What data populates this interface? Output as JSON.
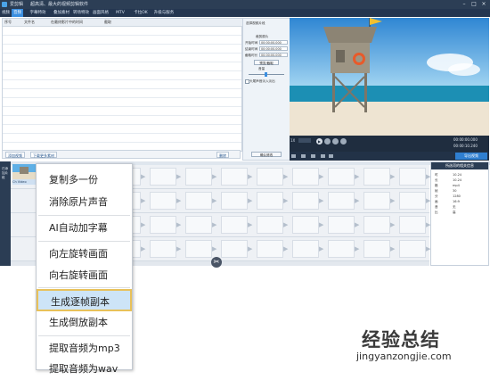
{
  "window": {
    "app_name": "爱剪辑",
    "title": "超高清、最大的视频剪辑软件",
    "buttons": [
      "–",
      "□",
      "×"
    ]
  },
  "tabs": [
    {
      "label": "视频"
    },
    {
      "label": "音频"
    },
    {
      "label": "字幕特效"
    },
    {
      "label": "叠加素材"
    },
    {
      "label": "转场特效"
    },
    {
      "label": "画面风格"
    },
    {
      "label": "MTV"
    },
    {
      "label": "卡拉OK"
    },
    {
      "label": "升级与服务"
    }
  ],
  "clip_list": {
    "columns": [
      "序号",
      "文件名",
      "在最终影片中的时间",
      "截取"
    ],
    "add_video_button": "添加视频",
    "download_button": "下载更多素材",
    "delete_button": "删除"
  },
  "settings": {
    "header": "选择视频片段",
    "section1": "裁剪原片",
    "start_label": "开始时间",
    "start_value": "00:00:00.000",
    "end_label": "结束时间",
    "end_value": "00:00:00.000",
    "duration_label": "截取时长",
    "duration_value": "00:00:00.000",
    "preview_button": "预览/截取",
    "volume_section": "音量",
    "checkbox_label": "头尾声音淡入淡出",
    "confirm_button": "确认修改"
  },
  "player": {
    "time_current": "00:00:00.000",
    "time_total": "00:00:10.240",
    "speed_value": "1X",
    "export_button": "导出视频"
  },
  "timeline": {
    "panel_label": "已添加片段",
    "clip_label": "Ch Video 01.mp4"
  },
  "props": {
    "header": "所选项的相关信息",
    "rows": [
      {
        "k": "时",
        "v": "10.24"
      },
      {
        "k": "长",
        "v": "10.24"
      },
      {
        "k": "格",
        "v": "mp4"
      },
      {
        "k": "帧",
        "v": "30"
      },
      {
        "k": "分",
        "v": "1280"
      },
      {
        "k": "画",
        "v": "16:9"
      },
      {
        "k": "音",
        "v": "无"
      },
      {
        "k": "比",
        "v": "高"
      }
    ]
  },
  "context_menu": {
    "items": [
      {
        "label": "复制多一份"
      },
      {
        "label": "消除原片声音"
      },
      {
        "label": "AI自动加字幕"
      },
      {
        "label": "向左旋转画面"
      },
      {
        "label": "向右旋转画面"
      },
      {
        "label": "生成逐帧副本",
        "highlighted": true
      },
      {
        "label": "生成倒放副本"
      },
      {
        "label": "提取音频为mp3"
      },
      {
        "label": "提取音频为wav"
      }
    ]
  },
  "watermark": {
    "cn": "经验总结",
    "en": "jingyanzongjie.com"
  },
  "colors": {
    "titlebar": "#2c3e55",
    "tab_active": "#3a8ee0",
    "menu_highlight": "#cde4f7",
    "menu_highlight_border": "#e8c15a"
  }
}
